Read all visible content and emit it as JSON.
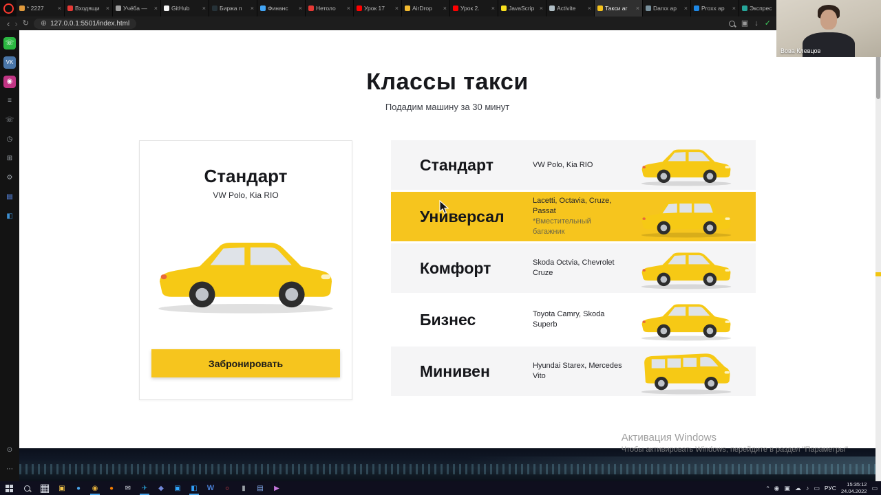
{
  "browser": {
    "url": "127.0.0.1:5501/index.html",
    "tabs": [
      {
        "label": "* 2227",
        "color": "#e09a3c"
      },
      {
        "label": "Входящи",
        "color": "#e53935"
      },
      {
        "label": "Учёба —",
        "color": "#9e9e9e"
      },
      {
        "label": "GitHub",
        "color": "#f5f5f5"
      },
      {
        "label": "Биржа п",
        "color": "#263238"
      },
      {
        "label": "Финанс",
        "color": "#42a5f5"
      },
      {
        "label": "Нетоло",
        "color": "#e53935"
      },
      {
        "label": "Урок 17",
        "color": "#ff0000"
      },
      {
        "label": "AirDrop",
        "color": "#f3ba2f"
      },
      {
        "label": "Урок 2.",
        "color": "#ff0000"
      },
      {
        "label": "JavaScrip",
        "color": "#f7df1e"
      },
      {
        "label": "Activite",
        "color": "#b0bec5"
      },
      {
        "label": "Такси аг",
        "color": "#f5c31d"
      },
      {
        "label": "Darxx ap",
        "color": "#78909c"
      },
      {
        "label": "Proxx ap",
        "color": "#1e88e5"
      },
      {
        "label": "Экспрес",
        "color": "#26a69a"
      }
    ]
  },
  "icons": {
    "close": "×",
    "back": "‹",
    "forward": "›",
    "reload": "↻",
    "site": "⊕",
    "screenshot": "▣",
    "download": "↓",
    "shield": "✓",
    "taskview": "▦",
    "tray_chevron": "^",
    "notification": "▭"
  },
  "sidebar": {
    "icons": [
      {
        "name": "whatsapp",
        "glyph": "☏",
        "bg": "#2bb741",
        "fg": "#ffffff"
      },
      {
        "name": "vk",
        "glyph": "VK",
        "bg": "#4a76a8",
        "fg": "#ffffff"
      },
      {
        "name": "instagram",
        "glyph": "◉",
        "bg": "#c13584",
        "fg": "#ffffff"
      },
      {
        "name": "menu",
        "glyph": "≡",
        "bg": "transparent",
        "fg": "#9aa0a6"
      },
      {
        "name": "calls",
        "glyph": "☏",
        "bg": "transparent",
        "fg": "#9aa0a6"
      },
      {
        "name": "history",
        "glyph": "◷",
        "bg": "transparent",
        "fg": "#9aa0a6"
      },
      {
        "name": "extensions",
        "glyph": "⊞",
        "bg": "transparent",
        "fg": "#9aa0a6"
      },
      {
        "name": "settings",
        "glyph": "⚙",
        "bg": "transparent",
        "fg": "#9aa0a6"
      },
      {
        "name": "bookmarks",
        "glyph": "▤",
        "bg": "transparent",
        "fg": "#5b8def"
      },
      {
        "name": "vscode",
        "glyph": "◧",
        "bg": "transparent",
        "fg": "#3d8fd1"
      },
      {
        "name": "profile",
        "glyph": "⊙",
        "bg": "transparent",
        "fg": "#9aa0a6"
      },
      {
        "name": "more",
        "glyph": "⋯",
        "bg": "transparent",
        "fg": "#9aa0a6"
      }
    ]
  },
  "page": {
    "title": "Классы такси",
    "subtitle": "Подадим машину за 30 минут",
    "card": {
      "title": "Стандарт",
      "models": "VW Polo, Kia RIO",
      "button": "Забронировать"
    },
    "classes": [
      {
        "name": "Стандарт",
        "models": "VW Polo, Kia RIO"
      },
      {
        "name": "Универсал",
        "models": "Lacetti, Octavia, Cruze, Passat",
        "note": "*Вместительный багажник"
      },
      {
        "name": "Комфорт",
        "models": "Skoda Octvia, Chevrolet Cruze"
      },
      {
        "name": "Бизнес",
        "models": "Toyota Camry, Skoda Superb"
      },
      {
        "name": "Минивен",
        "models": "Hyundai Starex, Mercedes Vito"
      }
    ],
    "highlight_color": "#f6c51e"
  },
  "watermark": {
    "line1": "Активация Windows",
    "line2": "Чтобы активировать Windows, перейдите в раздел \"Параметры\""
  },
  "webcam": {
    "name": "Вова Клевцов"
  },
  "taskbar": {
    "lang": "РУС",
    "time": "15:35:12",
    "date": "24.04.2022",
    "apps": [
      {
        "name": "explorer",
        "glyph": "▣",
        "color": "#f8c94c"
      },
      {
        "name": "edge",
        "glyph": "●",
        "color": "#4aa3e8"
      },
      {
        "name": "chrome",
        "glyph": "◉",
        "color": "#e8b33c"
      },
      {
        "name": "firefox",
        "glyph": "●",
        "color": "#f57c00"
      },
      {
        "name": "mail",
        "glyph": "✉",
        "color": "#cfd3dc"
      },
      {
        "name": "telegram",
        "glyph": "✈",
        "color": "#2aa3d8"
      },
      {
        "name": "discord",
        "glyph": "◆",
        "color": "#7289da"
      },
      {
        "name": "photoshop",
        "glyph": "▣",
        "color": "#31a8ff"
      },
      {
        "name": "vscode",
        "glyph": "◧",
        "color": "#2f9cf4"
      },
      {
        "name": "word",
        "glyph": "W",
        "color": "#4a7fd4"
      },
      {
        "name": "opera",
        "glyph": "○",
        "color": "#ff4b55"
      },
      {
        "name": "terminal",
        "glyph": "▮",
        "color": "#9aa0a6"
      },
      {
        "name": "notes",
        "glyph": "▤",
        "color": "#8ab4f8"
      },
      {
        "name": "player",
        "glyph": "▶",
        "color": "#c678dd"
      }
    ],
    "tray": [
      {
        "name": "obs",
        "glyph": "◉"
      },
      {
        "name": "defender",
        "glyph": "▣"
      },
      {
        "name": "cloud",
        "glyph": "☁"
      },
      {
        "name": "volume",
        "glyph": "♪"
      },
      {
        "name": "battery",
        "glyph": "▭"
      }
    ]
  }
}
